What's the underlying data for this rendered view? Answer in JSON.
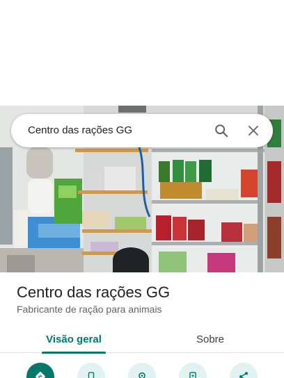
{
  "search": {
    "query": "Centro das rações GG"
  },
  "place": {
    "name": "Centro das rações GG",
    "category": "Fabricante de ração para animais"
  },
  "tabs": [
    {
      "label": "Visão geral",
      "selected": true
    },
    {
      "label": "Sobre",
      "selected": false
    }
  ],
  "actions": [
    {
      "icon": "directions-icon"
    },
    {
      "icon": "phone-icon"
    },
    {
      "icon": "location-icon"
    },
    {
      "icon": "save-icon"
    },
    {
      "icon": "share-icon"
    }
  ],
  "colors": {
    "accent": "#00796b",
    "accent_light": "#e0f2f1",
    "text_primary": "#202124",
    "text_secondary": "#5f6368"
  }
}
